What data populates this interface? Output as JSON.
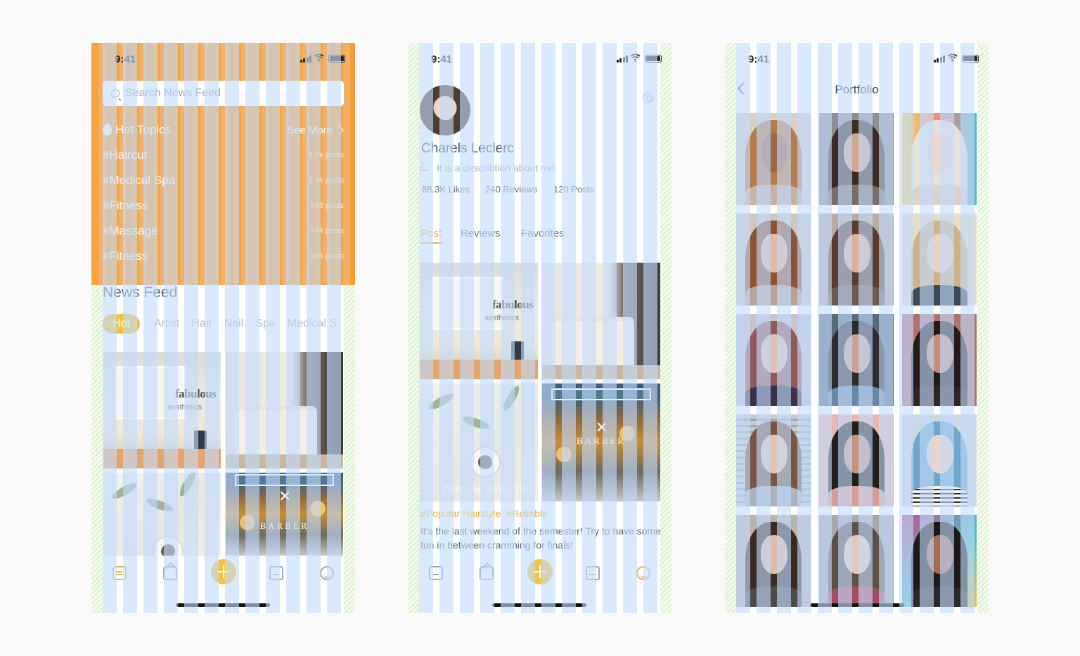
{
  "status_bar": {
    "time": "9:41"
  },
  "news_feed_screen": {
    "search": {
      "placeholder": "Search News Feed"
    },
    "hot_topics": {
      "title": "Hot Topics",
      "see_more": "See More",
      "items": [
        {
          "tag": "#Haircut",
          "count": "2.8k posts"
        },
        {
          "tag": "#Medical Spa",
          "count": "1.4k posts"
        },
        {
          "tag": "#Fitness",
          "count": "948 posts"
        },
        {
          "tag": "#Massage",
          "count": "744 posts"
        },
        {
          "tag": "#Fitness",
          "count": "426 posts"
        }
      ]
    },
    "feed_title": "News Feed",
    "categories": [
      "Hot",
      "Artist",
      "Hair",
      "Nail",
      "Spa",
      "Medical S"
    ],
    "active_category": "Hot",
    "photos": [
      {
        "subject": "salon interior",
        "logo_line1": "fabulous",
        "logo_line2": "aesthetics"
      },
      {
        "subject": "treatment room bed"
      },
      {
        "subject": "flat lay plants"
      },
      {
        "subject": "barber shop front",
        "sign": "BARBER"
      }
    ]
  },
  "profile_screen": {
    "name": "Charels Leclerc",
    "description": "It is a describtion about me.",
    "stats": {
      "likes": "88.3K Likes",
      "reviews": "240 Reviews",
      "posts": "120 Posts"
    },
    "tabs": [
      "Post",
      "Reviews",
      "Favorites"
    ],
    "active_tab": "Post",
    "post": {
      "location": "TAYA Hair Salon, 1km",
      "tags": [
        "#Popular Hairstyle",
        "#Reliable"
      ],
      "text": "It's the last weekend of the semester! Try to have some fun in between cramming for finals!"
    }
  },
  "portfolio_screen": {
    "title": "Portfolio",
    "photos": [
      "curly hair portrait",
      "woman looking up",
      "blonde with colorful background",
      "auburn hair portrait",
      "woman with long hair",
      "blonde side portrait",
      "woman hand on head",
      "woman in denim",
      "dark hair portrait",
      "woman by blinds",
      "woman with bun",
      "blue hair woman",
      "woman with glasses",
      "woman hand on face",
      "woman colorful wall"
    ]
  },
  "tab_bar": {
    "icons": [
      "news-feed-icon",
      "home-icon",
      "add-icon",
      "calendar-icon",
      "profile-icon"
    ]
  },
  "colors": {
    "accent": "#f3c33a",
    "hot_topics_band": "#f5a53c",
    "grid_overlay": "#c2dbfd",
    "gutter": "#dcf0cf",
    "text_dark": "#41556c",
    "text_muted": "#a3adbb"
  }
}
